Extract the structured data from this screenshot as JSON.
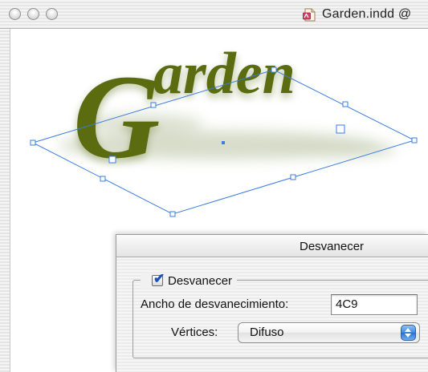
{
  "window": {
    "title": "Garden.indd @",
    "buttons": [
      "close",
      "minimize",
      "zoom"
    ]
  },
  "artwork": {
    "text": "Garden",
    "initial": "G",
    "rest": "arden",
    "color": "#5a6b10",
    "selection_color": "#3b7ce0"
  },
  "dialog": {
    "title": "Desvanecer",
    "enable_checkbox": {
      "label": "Desvanecer",
      "checked": true
    },
    "width_label": "Ancho de desvanecimiento:",
    "width_value": "4C9",
    "corners_label": "Vértices:",
    "corners_value": "Difuso",
    "popup_accent": "#3f8ae0"
  },
  "icons": {
    "document": "indesign-document-icon",
    "popup": "up-down-arrows-icon",
    "check": "checkmark-icon"
  }
}
